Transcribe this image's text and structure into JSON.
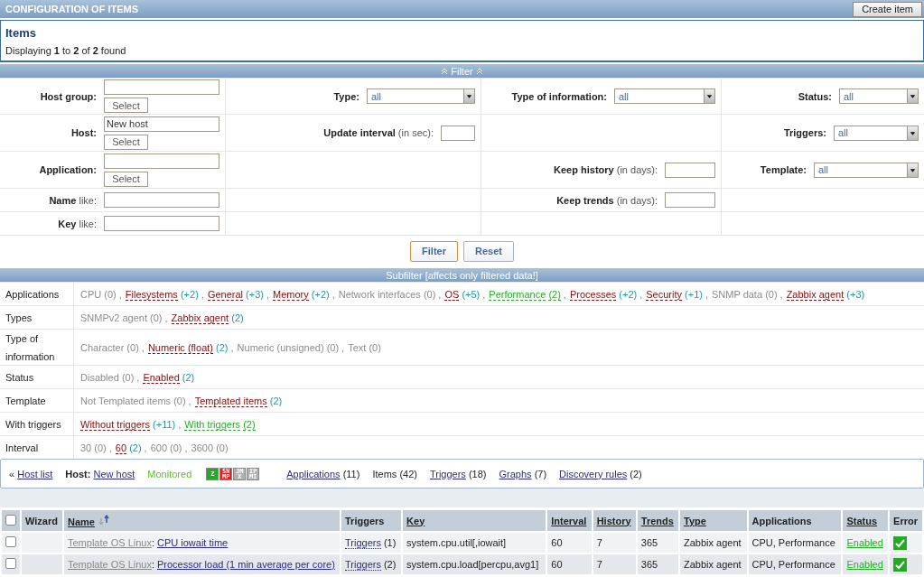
{
  "header": {
    "title": "CONFIGURATION OF ITEMS",
    "button": "Create item"
  },
  "summary": {
    "title": "Items",
    "text": "Displaying **1** to **2** of **2** found"
  },
  "filter": {
    "title": "Filter",
    "expanded": true,
    "rows": [
      [
        {
          "kind": "picker",
          "label": "Host group:",
          "button": "Select"
        },
        {
          "kind": "select",
          "label": "Type:",
          "value": "all"
        },
        {
          "kind": "select",
          "label": "Type of information:",
          "value": "all"
        },
        {
          "kind": "select",
          "label": "Status:",
          "value": "all"
        }
      ],
      [
        {
          "kind": "picker",
          "label": "Host:",
          "value": "New host",
          "button": "Select"
        },
        {
          "kind": "input",
          "label": "**Update interval** (in sec):"
        },
        {
          "kind": "blank"
        },
        {
          "kind": "select",
          "label": "Triggers:",
          "value": "all"
        }
      ],
      [
        {
          "kind": "picker",
          "label": "Application:",
          "button": "Select"
        },
        {
          "kind": "blank"
        },
        {
          "kind": "input",
          "label": "**Keep history** (in days):"
        },
        {
          "kind": "select",
          "label": "Template:",
          "value": "all"
        }
      ],
      [
        {
          "kind": "input",
          "label": "**Name** like:"
        },
        {
          "kind": "blank"
        },
        {
          "kind": "input",
          "label": "**Keep trends** (in days):"
        },
        {
          "kind": "blank"
        }
      ],
      [
        {
          "kind": "input",
          "label": "**Key** like:"
        },
        {
          "kind": "blank"
        },
        {
          "kind": "blank"
        },
        {
          "kind": "blank"
        }
      ]
    ],
    "buttons": [
      {
        "label": "Filter",
        "primary": true
      },
      {
        "label": "Reset",
        "primary": false
      }
    ]
  },
  "subfilter": {
    "title": "Subfilter [affects only filtered data!]",
    "separator": ",",
    "rows": [
      {
        "label": "Applications",
        "options": [
          {
            "name": "CPU",
            "count": "(0)",
            "kind": "empty"
          },
          {
            "name": "Filesystems",
            "count": "(+2)",
            "kind": "available"
          },
          {
            "name": "General",
            "count": "(+3)",
            "kind": "available"
          },
          {
            "name": "Memory",
            "count": "(+2)",
            "kind": "available"
          },
          {
            "name": "Network interfaces",
            "count": "(0)",
            "kind": "empty"
          },
          {
            "name": "OS",
            "count": "(+5)",
            "kind": "available"
          },
          {
            "name": "Performance",
            "count": "(2)",
            "kind": "selected"
          },
          {
            "name": "Processes",
            "count": "(+2)",
            "kind": "available"
          },
          {
            "name": "Security",
            "count": "(+1)",
            "kind": "available"
          },
          {
            "name": "SNMP data",
            "count": "(0)",
            "kind": "empty"
          },
          {
            "name": "Zabbix agent",
            "count": "(+3)",
            "kind": "available"
          }
        ]
      },
      {
        "label": "Types",
        "options": [
          {
            "name": "SNMPv2 agent",
            "count": "(0)",
            "kind": "empty"
          },
          {
            "name": "Zabbix agent",
            "count": "(2)",
            "kind": "available"
          }
        ]
      },
      {
        "label": "Type of information",
        "options": [
          {
            "name": "Character",
            "count": "(0)",
            "kind": "empty"
          },
          {
            "name": "Numeric (float)",
            "count": "(2)",
            "kind": "available"
          },
          {
            "name": "Numeric (unsigned)",
            "count": "(0)",
            "kind": "empty"
          },
          {
            "name": "Text",
            "count": "(0)",
            "kind": "empty"
          }
        ]
      },
      {
        "label": "Status",
        "options": [
          {
            "name": "Disabled",
            "count": "(0)",
            "kind": "empty"
          },
          {
            "name": "Enabled",
            "count": "(2)",
            "kind": "available"
          }
        ]
      },
      {
        "label": "Template",
        "options": [
          {
            "name": "Not Templated items",
            "count": "(0)",
            "kind": "empty"
          },
          {
            "name": "Templated items",
            "count": "(2)",
            "kind": "available"
          }
        ]
      },
      {
        "label": "With triggers",
        "options": [
          {
            "name": "Without triggers",
            "count": "(+11)",
            "kind": "available"
          },
          {
            "name": "With triggers",
            "count": "(2)",
            "kind": "selected"
          }
        ]
      },
      {
        "label": "Interval",
        "options": [
          {
            "name": "30",
            "count": "(0)",
            "kind": "empty"
          },
          {
            "name": "60",
            "count": "(2)",
            "kind": "available"
          },
          {
            "name": "600",
            "count": "(0)",
            "kind": "empty"
          },
          {
            "name": "3600",
            "count": "(0)",
            "kind": "empty"
          }
        ]
      }
    ]
  },
  "host_nav": {
    "back": "«",
    "back_link": "Host list",
    "host_label": "Host:",
    "host": "New host",
    "status": "Monitored",
    "availability": [
      {
        "label": "Z",
        "color": "#22aa22"
      },
      {
        "label": "SNMP",
        "color": "#dd2222"
      },
      {
        "label": "JMX",
        "color": "#b0b0b0"
      },
      {
        "label": "IPMI",
        "color": "#b0b0b0"
      }
    ],
    "links": [
      {
        "label": "Applications",
        "count": "(11)",
        "link": true
      },
      {
        "label": "Items",
        "count": "(42)",
        "link": false
      },
      {
        "label": "Triggers",
        "count": "(18)",
        "link": true
      },
      {
        "label": "Graphs",
        "count": "(7)",
        "link": true
      },
      {
        "label": "Discovery rules",
        "count": "(2)",
        "link": true
      }
    ]
  },
  "table": {
    "select_all": {
      "checked": false
    },
    "name_separator": ":",
    "columns": [
      {
        "label": "Wizard",
        "sortable": false
      },
      {
        "label": "Name",
        "sortable": true,
        "sorted_ascending": true
      },
      {
        "label": "Triggers",
        "sortable": false
      },
      {
        "label": "Key",
        "sortable": true
      },
      {
        "label": "Interval",
        "sortable": true
      },
      {
        "label": "History",
        "sortable": true
      },
      {
        "label": "Trends",
        "sortable": true
      },
      {
        "label": "Type",
        "sortable": true
      },
      {
        "label": "Applications",
        "sortable": false
      },
      {
        "label": "Status",
        "sortable": true
      },
      {
        "label": "Error",
        "sortable": false
      }
    ],
    "rows": [
      {
        "checked": false,
        "template": "Template OS Linux",
        "name": "CPU iowait time",
        "triggers": "Triggers",
        "trigger_count": "(1)",
        "key": "system.cpu.util[,iowait]",
        "interval": "60",
        "history": "7",
        "trends": "365",
        "type": "Zabbix agent",
        "applications": "CPU, Performance",
        "status": "Enabled",
        "enabled": true,
        "error_free": true
      },
      {
        "checked": false,
        "template": "Template OS Linux",
        "name": "Processor load (1 min average per core)",
        "triggers": "Triggers",
        "trigger_count": "(2)",
        "key": "system.cpu.load[percpu,avg1]",
        "interval": "60",
        "history": "7",
        "trends": "365",
        "type": "Zabbix agent",
        "applications": "CPU, Performance",
        "status": "Enabled",
        "enabled": true,
        "error_free": true
      }
    ]
  }
}
